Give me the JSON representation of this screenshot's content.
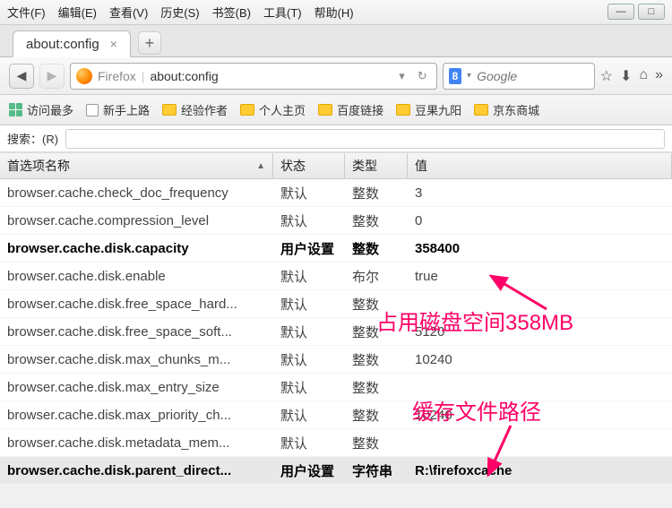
{
  "menu": {
    "file": "文件(F)",
    "edit": "编辑(E)",
    "view": "查看(V)",
    "history": "历史(S)",
    "bookmarks": "书签(B)",
    "tools": "工具(T)",
    "help": "帮助(H)"
  },
  "tab": {
    "title": "about:config"
  },
  "url": {
    "brand": "Firefox",
    "addr": "about:config"
  },
  "search": {
    "placeholder": "Google"
  },
  "bookmarks": {
    "most": "访问最多",
    "novice": "新手上路",
    "exp": "经验作者",
    "personal": "个人主页",
    "baidu": "百度链接",
    "douguo": "豆果九阳",
    "jd": "京东商城"
  },
  "filter": {
    "label": "搜索：(R)"
  },
  "columns": {
    "name": "首选项名称",
    "state": "状态",
    "type": "类型",
    "value": "值"
  },
  "rows": [
    {
      "name": "browser.cache.check_doc_frequency",
      "state": "默认",
      "type": "整数",
      "value": "3",
      "bold": false,
      "sel": false
    },
    {
      "name": "browser.cache.compression_level",
      "state": "默认",
      "type": "整数",
      "value": "0",
      "bold": false,
      "sel": false
    },
    {
      "name": "browser.cache.disk.capacity",
      "state": "用户设置",
      "type": "整数",
      "value": "358400",
      "bold": true,
      "sel": false
    },
    {
      "name": "browser.cache.disk.enable",
      "state": "默认",
      "type": "布尔",
      "value": "true",
      "bold": false,
      "sel": false
    },
    {
      "name": "browser.cache.disk.free_space_hard...",
      "state": "默认",
      "type": "整数",
      "value": "",
      "bold": false,
      "sel": false
    },
    {
      "name": "browser.cache.disk.free_space_soft...",
      "state": "默认",
      "type": "整数",
      "value": "5120",
      "bold": false,
      "sel": false
    },
    {
      "name": "browser.cache.disk.max_chunks_m...",
      "state": "默认",
      "type": "整数",
      "value": "10240",
      "bold": false,
      "sel": false
    },
    {
      "name": "browser.cache.disk.max_entry_size",
      "state": "默认",
      "type": "整数",
      "value": "",
      "bold": false,
      "sel": false
    },
    {
      "name": "browser.cache.disk.max_priority_ch...",
      "state": "默认",
      "type": "整数",
      "value": "10240",
      "bold": false,
      "sel": false
    },
    {
      "name": "browser.cache.disk.metadata_mem...",
      "state": "默认",
      "type": "整数",
      "value": "",
      "bold": false,
      "sel": false
    },
    {
      "name": "browser.cache.disk.parent_direct...",
      "state": "用户设置",
      "type": "字符串",
      "value": "R:\\firefoxcache",
      "bold": true,
      "sel": true
    }
  ],
  "annot": {
    "space": "占用磁盘空间358MB",
    "path": "缓存文件路径"
  }
}
